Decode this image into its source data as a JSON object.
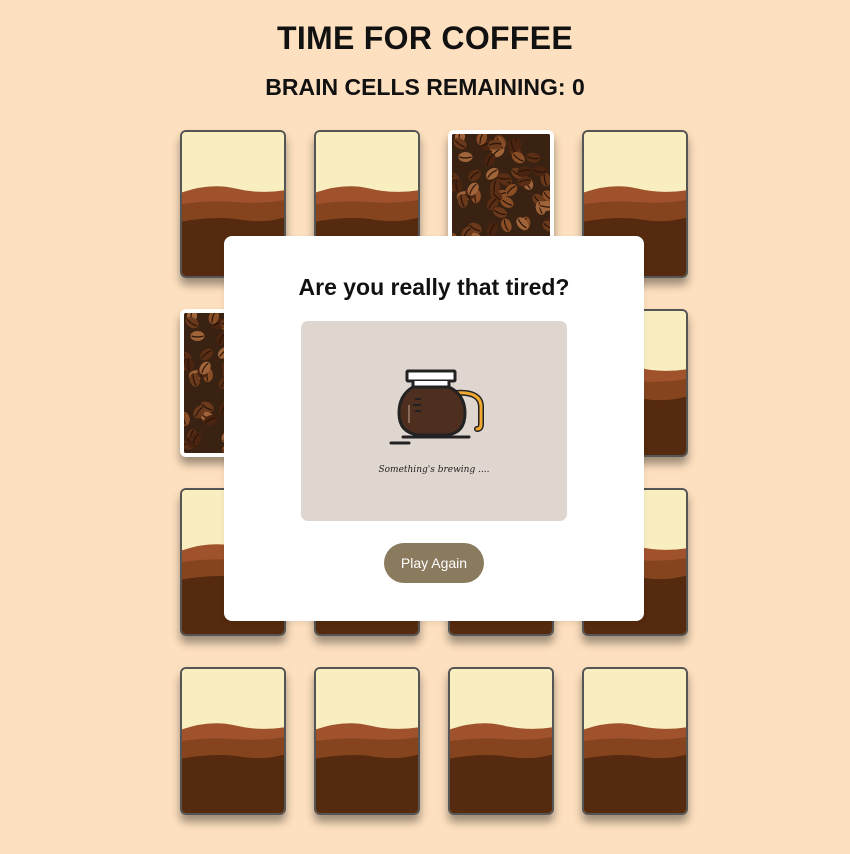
{
  "game": {
    "title": "TIME FOR COFFEE",
    "score_label": "BRAIN CELLS REMAINING:",
    "score_value": "0"
  },
  "cards": [
    {
      "state": "back"
    },
    {
      "state": "back"
    },
    {
      "state": "flipped",
      "image": "coffee-beans"
    },
    {
      "state": "back"
    },
    {
      "state": "flipped",
      "image": "coffee-beans"
    },
    {
      "state": "back"
    },
    {
      "state": "back"
    },
    {
      "state": "back"
    },
    {
      "state": "back"
    },
    {
      "state": "back"
    },
    {
      "state": "back"
    },
    {
      "state": "back"
    },
    {
      "state": "back"
    },
    {
      "state": "back"
    },
    {
      "state": "back"
    },
    {
      "state": "back"
    }
  ],
  "modal": {
    "title": "Are you really that tired?",
    "caption": "Something's brewing ....",
    "button_label": "Play Again",
    "image_icon": "coffee-pot-icon"
  },
  "colors": {
    "background": "#fde0bf",
    "card_cream": "#f8eec0",
    "card_crema": "#a0522d",
    "card_coffee": "#552a0e",
    "button": "#8a7a5e",
    "gif_background": "#e0d6d0"
  }
}
